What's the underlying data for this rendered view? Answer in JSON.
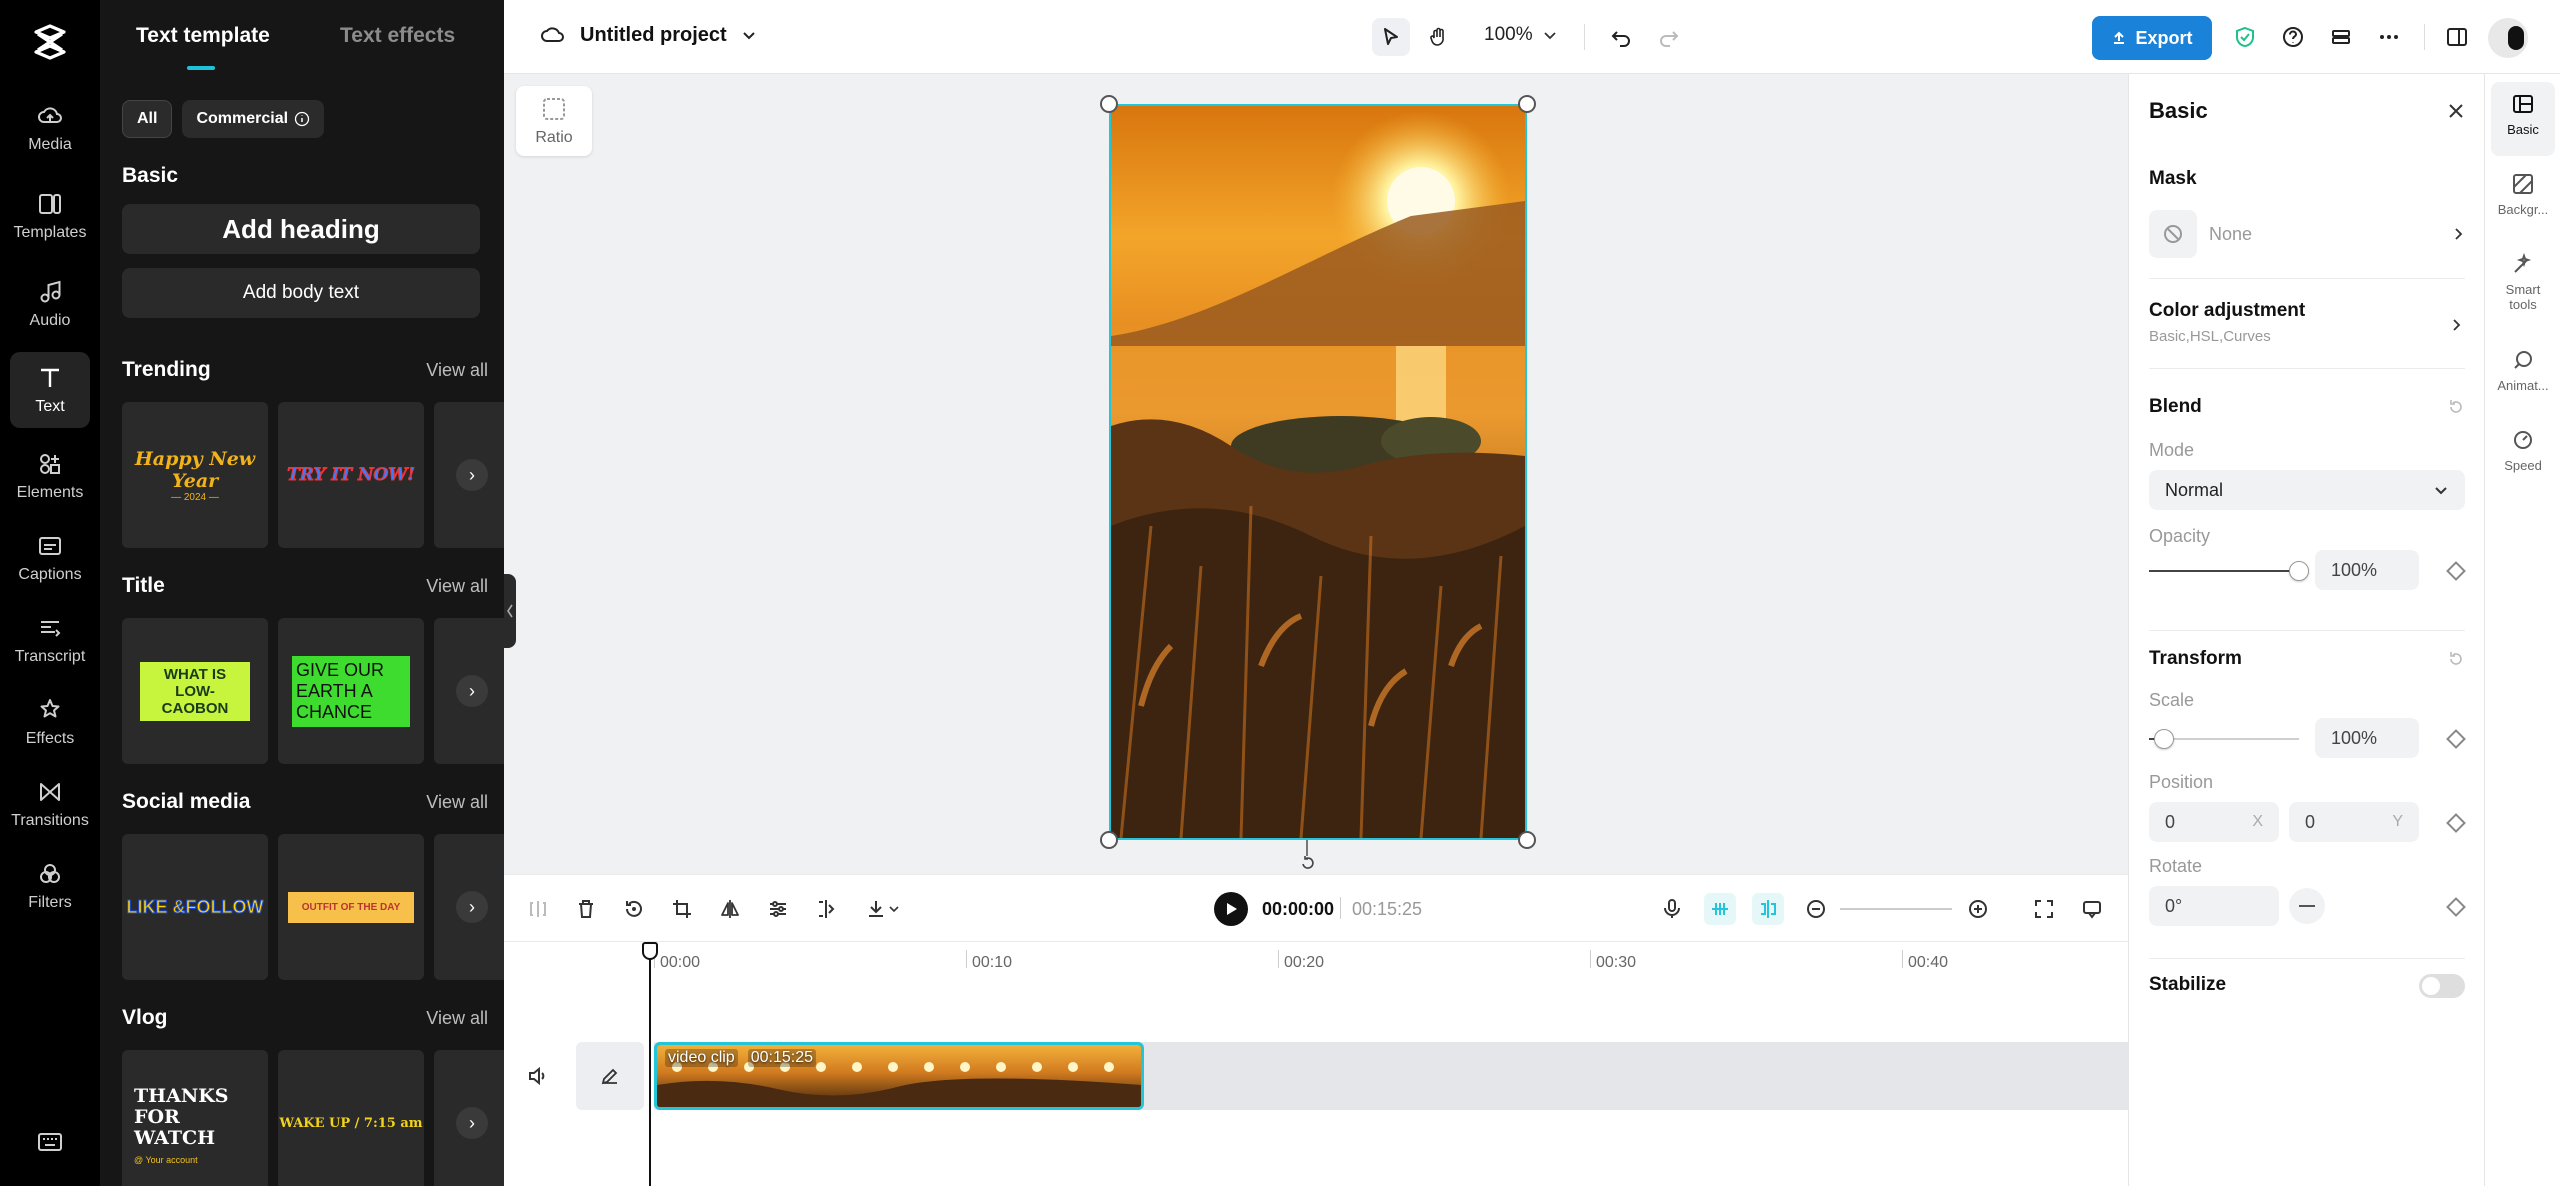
{
  "rail": {
    "items": [
      {
        "label": "Media",
        "icon": "media-cloud-icon"
      },
      {
        "label": "Templates",
        "icon": "templates-icon"
      },
      {
        "label": "Audio",
        "icon": "music-note-icon"
      },
      {
        "label": "Text",
        "icon": "text-icon"
      },
      {
        "label": "Elements",
        "icon": "elements-icon"
      },
      {
        "label": "Captions",
        "icon": "captions-icon"
      },
      {
        "label": "Transcript",
        "icon": "transcript-icon"
      },
      {
        "label": "Effects",
        "icon": "effects-icon"
      },
      {
        "label": "Transitions",
        "icon": "transitions-icon"
      },
      {
        "label": "Filters",
        "icon": "filters-icon"
      }
    ],
    "active": "Text"
  },
  "library": {
    "tabs": [
      "Text template",
      "Text effects"
    ],
    "chips": {
      "all": "All",
      "commercial": "Commercial"
    },
    "basic": {
      "title": "Basic",
      "add_heading": "Add heading",
      "add_body": "Add body text"
    },
    "sections": [
      {
        "title": "Trending",
        "view_all": "View all",
        "cards": [
          "Happy New Year",
          "TRY IT NOW!"
        ]
      },
      {
        "title": "Title",
        "view_all": "View all",
        "cards": [
          "WHAT IS LOW-CAOBON",
          "GIVE OUR EARTH A CHANCE"
        ]
      },
      {
        "title": "Social media",
        "view_all": "View all",
        "cards": [
          "LIKE &FOLLOW",
          "OUTFIT OF THE DAY"
        ]
      },
      {
        "title": "Vlog",
        "view_all": "View all",
        "cards": [
          "THANKS FOR WATCH",
          "WAKE UP / 7:15 am"
        ]
      }
    ],
    "card_extras": {
      "trending_year": "— 2024 —",
      "social_account": "@ Your account"
    }
  },
  "topbar": {
    "project_name": "Untitled project",
    "zoom": "100%",
    "export_label": "Export"
  },
  "canvas": {
    "ratio_label": "Ratio"
  },
  "player": {
    "current_time": "00:00:00",
    "total_time": "00:15:25"
  },
  "timeline": {
    "ruler": [
      "00:00",
      "00:10",
      "00:20",
      "00:30",
      "00:40"
    ],
    "clip_name": "video clip",
    "clip_duration": "00:15:25"
  },
  "properties": {
    "header": "Basic",
    "mask": {
      "title": "Mask",
      "value": "None"
    },
    "color_adjustment": {
      "title": "Color adjustment",
      "sub": "Basic,HSL,Curves"
    },
    "blend": {
      "title": "Blend",
      "mode_label": "Mode",
      "mode_value": "Normal",
      "opacity_label": "Opacity",
      "opacity_value": "100%",
      "opacity_level": 1.0
    },
    "transform": {
      "title": "Transform",
      "scale_label": "Scale",
      "scale_value": "100%",
      "scale_level": 0.1,
      "position_label": "Position",
      "pos_x": "0",
      "pos_x_axis": "X",
      "pos_y": "0",
      "pos_y_axis": "Y",
      "rotate_label": "Rotate",
      "rotate_value": "0°"
    },
    "stabilize": {
      "title": "Stabilize",
      "enabled": false
    }
  },
  "right_rail": {
    "items": [
      {
        "label": "Basic",
        "icon": "basic-icon"
      },
      {
        "label": "Backgr...",
        "icon": "background-icon"
      },
      {
        "label": "Smart tools",
        "icon": "smart-tools-icon"
      },
      {
        "label": "Animat...",
        "icon": "animation-icon"
      },
      {
        "label": "Speed",
        "icon": "speed-icon"
      }
    ]
  },
  "colors": {
    "accent": "#23c5d9",
    "export": "#1a82d8",
    "panel_dark": "#161616"
  }
}
